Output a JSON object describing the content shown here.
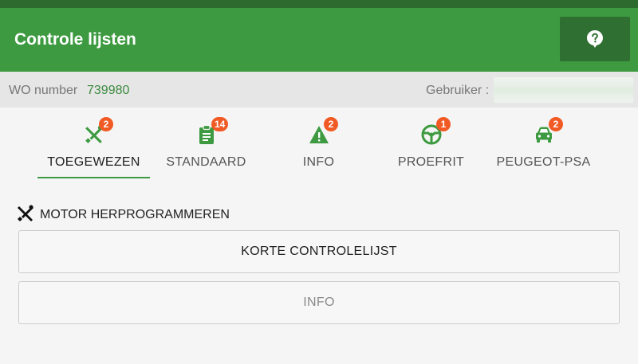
{
  "app": {
    "title": "Controle lijsten"
  },
  "header": {
    "help_icon": "help-circle-icon"
  },
  "info": {
    "wo_label": "WO number",
    "wo_value": "739980",
    "user_label": "Gebruiker :"
  },
  "tabs": [
    {
      "label": "TOEGEWEZEN",
      "badge": "2",
      "icon": "tools-icon",
      "active": true
    },
    {
      "label": "STANDAARD",
      "badge": "14",
      "icon": "clipboard-icon",
      "active": false
    },
    {
      "label": "INFO",
      "badge": "2",
      "icon": "warning-icon",
      "active": false
    },
    {
      "label": "PROEFRIT",
      "badge": "1",
      "icon": "steering-wheel-icon",
      "active": false
    },
    {
      "label": "PEUGEOT-PSA",
      "badge": "2",
      "icon": "car-icon",
      "active": false
    }
  ],
  "section": {
    "title": "MOTOR HERPROGRAMMEREN",
    "icon": "tools-icon",
    "items": [
      {
        "label": "KORTE CONTROLELIJST"
      },
      {
        "label": "INFO"
      }
    ]
  },
  "colors": {
    "primary": "#3d9a40",
    "primary_dark": "#2f6f31",
    "badge": "#f15a24"
  }
}
